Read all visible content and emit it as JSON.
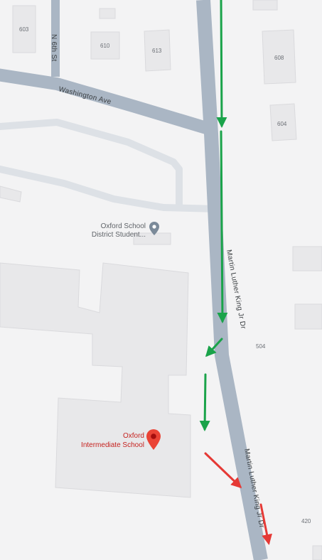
{
  "streets": {
    "washington": "Washington Ave",
    "mlk_upper": "Martin Luther King Jr Dr",
    "mlk_lower": "Martin Luther King Jr Dr",
    "n6th": "N 6th St"
  },
  "addresses": [
    "603",
    "610",
    "613",
    "608",
    "604",
    "504",
    "420"
  ],
  "pois": {
    "student_center": {
      "line1": "Oxford School",
      "line2": "District Student..."
    },
    "intermediate_school": {
      "line1": "Oxford",
      "line2": "Intermediate School"
    }
  },
  "icons": {
    "gray_pin": "place-pin-icon",
    "red_pin": "selected-place-pin-icon"
  },
  "colors": {
    "background": "#f3f3f4",
    "building": "#e8e8ea",
    "road": "#aab6c4",
    "minor_road": "#dde1e6",
    "route_arrow_green": "#1aa34a",
    "route_arrow_red": "#e53935",
    "poi_gray": "#5f6368",
    "poi_red": "#c5221f"
  },
  "route_arrows": {
    "green_count": 4,
    "red_count": 2
  }
}
